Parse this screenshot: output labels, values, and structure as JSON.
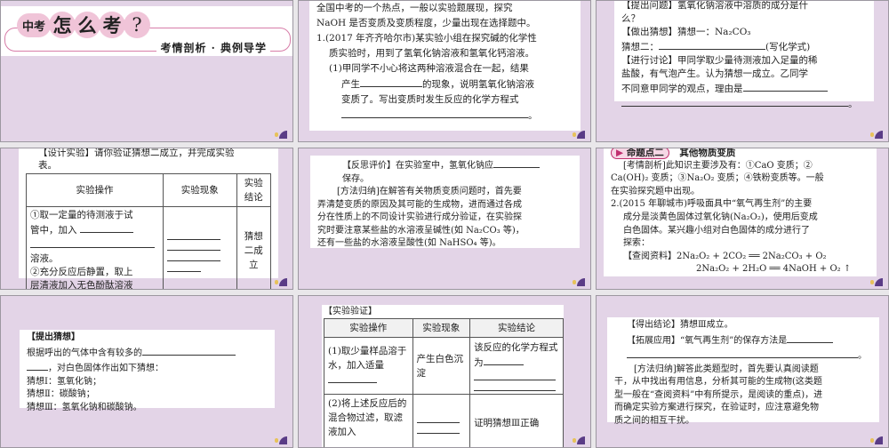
{
  "p1": {
    "chars": [
      "中考",
      "怎",
      "么",
      "考",
      "?"
    ],
    "subtitle": "考情剖析 · 典例导学"
  },
  "p2": {
    "lines": [
      "全国中考的一个热点，一般以实验题展现，探究",
      "NaOH 是否变质及变质程度，少量出现在选择题中。",
      "1.(2017 年齐齐哈尔市)某实验小组在探究碱的化学性",
      "质实验时，用到了氢氧化钠溶液和氢氧化钙溶液。",
      "(1)甲同学不小心将这两种溶液混合在一起，结果",
      "产生",
      "的现象，说明氢氧化钠溶液",
      "变质了。写出变质时发生反应的化学方程式",
      "。"
    ]
  },
  "p3": {
    "lines": [
      "【提出问题】氢氧化钠溶液中溶质的成分是什",
      "么？",
      "【做出猜想】猜想一：Na₂CO₃",
      "猜想二：",
      "(写化学式)",
      "【进行讨论】甲同学取少量待测液加入足量的稀",
      "盐酸，有气泡产生。认为猜想一成立。乙同学",
      "不同意甲同学的观点，理由是",
      "。"
    ]
  },
  "p4": {
    "intro": [
      "【设计实验】请你验证猜想二成立，并完成实验",
      "表。"
    ],
    "headers": [
      "实验操作",
      "实验现象",
      "实验结论"
    ],
    "op": [
      "①取一定量的待测液于试",
      "管中，加入",
      "溶液。",
      "②充分反应后静置，取上",
      "层清液加入无色酚酞溶液"
    ],
    "conclusion": "猜想二成立"
  },
  "p5": {
    "lines": [
      "【反思评价】在实验室中，氢氧化钠应",
      "保存。",
      "[方法归纳]在解答有关物质变质问题时，首先要",
      "弄清楚变质的原因及其可能的生成物，进而通过各成",
      "分在性质上的不同设计实验进行成分验证，在实验探",
      "究时要注意某些盐的水溶液呈碱性(如 Na₂CO₃ 等)，",
      "还有一些盐的水溶液呈酸性(如 NaHSO₄ 等)。"
    ]
  },
  "p6": {
    "badge": "命题点二",
    "title": "其他物质变质",
    "lines": [
      "[考情剖析]此知识主要涉及有：①CaO 变质；②",
      "Ca(OH)₂ 变质；③Na₂O₂ 变质；④铁粉变质等。一般",
      "在实验探究题中出现。",
      "2.(2015 年聊城市)呼吸面具中“氧气再生剂”的主要",
      "成分是淡黄色固体过氧化钠(Na₂O₂)，使用后变成",
      "白色固体。某兴趣小组对白色固体的成分进行了",
      "探索：",
      "【查阅资料】2Na₂O₂ + 2CO₂ ══ 2Na₂CO₃ + O₂",
      "2Na₂O₂ + 2H₂O ══ 4NaOH + O₂ ↑"
    ]
  },
  "p7": {
    "lines": [
      "【提出猜想】",
      "根据呼出的气体中含有较多的",
      "，对白色固体作出如下猜想：",
      "猜想Ⅰ：氢氧化钠；",
      "猜想Ⅱ：碳酸钠；",
      "猜想Ⅲ：氢氧化钠和碳酸钠。"
    ]
  },
  "p8": {
    "title": "【实验验证】",
    "headers": [
      "实验操作",
      "实验现象",
      "实验结论"
    ],
    "r1": [
      "(1)取少量样品溶于水，加入适量",
      "产生白色沉淀",
      "该反应的化学方程式为"
    ],
    "r2": [
      "(2)将上述反应后的混合物过滤，取滤液加入",
      "证明猜想Ⅲ正确"
    ]
  },
  "p9": {
    "lines": [
      "【得出结论】猜想Ⅲ成立。",
      "【拓展应用】“氧气再生剂”的保存方法是",
      "。",
      "[方法归纳]解答此类题型时，首先要认真阅读题",
      "干，从中找出有用信息，分析其可能的生成物(这类题",
      "型一般在“查阅资料”中有所提示，是阅读的重点)，进",
      "而确定实验方案进行探究，在验证时，应注意避免物",
      "质之间的相互干扰。"
    ]
  },
  "colors": {
    "panel": "#e3d4e7",
    "accent": "#f0c4d8",
    "deco": "#5a3c86"
  }
}
